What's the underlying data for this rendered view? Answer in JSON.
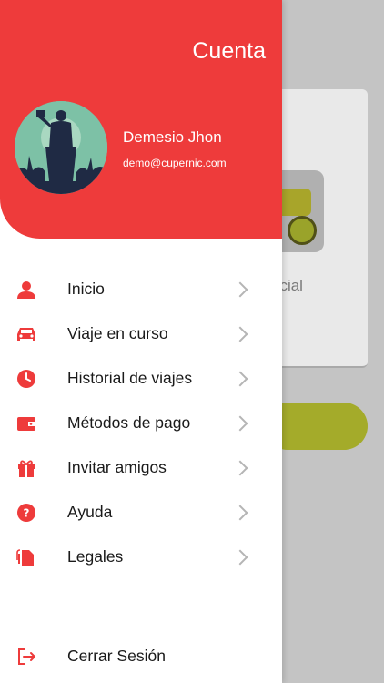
{
  "background": {
    "tile_label": "ecial"
  },
  "header": {
    "title": "Cuenta",
    "user_name": "Demesio Jhon",
    "user_email": "demo@cupernic.com"
  },
  "menu": {
    "items": [
      {
        "label": "Inicio",
        "icon": "user-icon"
      },
      {
        "label": "Viaje en curso",
        "icon": "car-icon"
      },
      {
        "label": "Historial de viajes",
        "icon": "clock-icon"
      },
      {
        "label": "Métodos de pago",
        "icon": "wallet-icon"
      },
      {
        "label": "Invitar amigos",
        "icon": "gift-icon"
      },
      {
        "label": "Ayuda",
        "icon": "help-icon"
      },
      {
        "label": "Legales",
        "icon": "documents-icon"
      }
    ],
    "logout_label": "Cerrar Sesión"
  },
  "colors": {
    "accent": "#ee3b3b",
    "text": "#1a1a1a",
    "chevron": "#b5b5b5"
  }
}
